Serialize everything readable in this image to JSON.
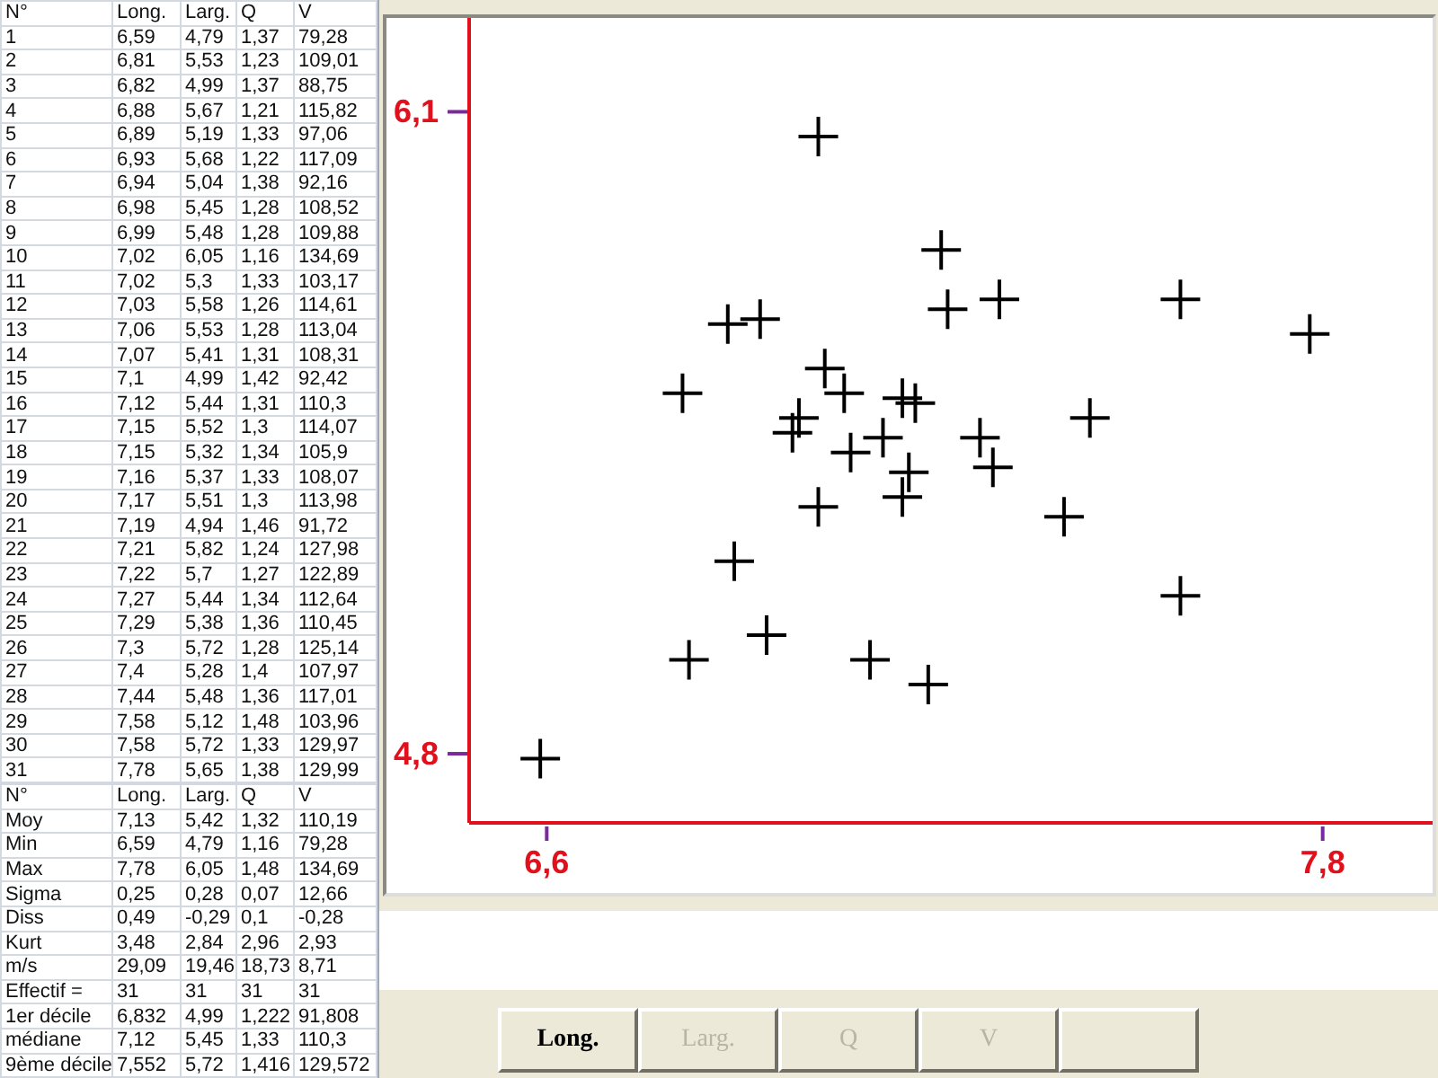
{
  "table": {
    "columns": [
      "N°",
      "Long.",
      "Larg.",
      "Q",
      "V"
    ],
    "rows": [
      [
        "1",
        "6,59",
        "4,79",
        "1,37",
        "79,28"
      ],
      [
        "2",
        "6,81",
        "5,53",
        "1,23",
        "109,01"
      ],
      [
        "3",
        "6,82",
        "4,99",
        "1,37",
        "88,75"
      ],
      [
        "4",
        "6,88",
        "5,67",
        "1,21",
        "115,82"
      ],
      [
        "5",
        "6,89",
        "5,19",
        "1,33",
        "97,06"
      ],
      [
        "6",
        "6,93",
        "5,68",
        "1,22",
        "117,09"
      ],
      [
        "7",
        "6,94",
        "5,04",
        "1,38",
        "92,16"
      ],
      [
        "8",
        "6,98",
        "5,45",
        "1,28",
        "108,52"
      ],
      [
        "9",
        "6,99",
        "5,48",
        "1,28",
        "109,88"
      ],
      [
        "10",
        "7,02",
        "6,05",
        "1,16",
        "134,69"
      ],
      [
        "11",
        "7,02",
        "5,3",
        "1,33",
        "103,17"
      ],
      [
        "12",
        "7,03",
        "5,58",
        "1,26",
        "114,61"
      ],
      [
        "13",
        "7,06",
        "5,53",
        "1,28",
        "113,04"
      ],
      [
        "14",
        "7,07",
        "5,41",
        "1,31",
        "108,31"
      ],
      [
        "15",
        "7,1",
        "4,99",
        "1,42",
        "92,42"
      ],
      [
        "16",
        "7,12",
        "5,44",
        "1,31",
        "110,3"
      ],
      [
        "17",
        "7,15",
        "5,52",
        "1,3",
        "114,07"
      ],
      [
        "18",
        "7,15",
        "5,32",
        "1,34",
        "105,9"
      ],
      [
        "19",
        "7,16",
        "5,37",
        "1,33",
        "108,07"
      ],
      [
        "20",
        "7,17",
        "5,51",
        "1,3",
        "113,98"
      ],
      [
        "21",
        "7,19",
        "4,94",
        "1,46",
        "91,72"
      ],
      [
        "22",
        "7,21",
        "5,82",
        "1,24",
        "127,98"
      ],
      [
        "23",
        "7,22",
        "5,7",
        "1,27",
        "122,89"
      ],
      [
        "24",
        "7,27",
        "5,44",
        "1,34",
        "112,64"
      ],
      [
        "25",
        "7,29",
        "5,38",
        "1,36",
        "110,45"
      ],
      [
        "26",
        "7,3",
        "5,72",
        "1,28",
        "125,14"
      ],
      [
        "27",
        "7,4",
        "5,28",
        "1,4",
        "107,97"
      ],
      [
        "28",
        "7,44",
        "5,48",
        "1,36",
        "117,01"
      ],
      [
        "29",
        "7,58",
        "5,12",
        "1,48",
        "103,96"
      ],
      [
        "30",
        "7,58",
        "5,72",
        "1,33",
        "129,97"
      ],
      [
        "31",
        "7,78",
        "5,65",
        "1,38",
        "129,99"
      ]
    ]
  },
  "stats": {
    "columns": [
      "N°",
      "Long.",
      "Larg.",
      "Q",
      "V"
    ],
    "rows": [
      [
        "Moy",
        "7,13",
        "5,42",
        "1,32",
        "110,19"
      ],
      [
        "Min",
        "6,59",
        "4,79",
        "1,16",
        "79,28"
      ],
      [
        "Max",
        "7,78",
        "6,05",
        "1,48",
        "134,69"
      ],
      [
        "Sigma",
        "0,25",
        "0,28",
        "0,07",
        "12,66"
      ],
      [
        "Diss",
        "0,49",
        "-0,29",
        "0,1",
        "-0,28"
      ],
      [
        "Kurt",
        "3,48",
        "2,84",
        "2,96",
        "2,93"
      ],
      [
        "m/s",
        "29,09",
        "19,46",
        "18,73",
        "8,71"
      ],
      [
        "Effectif =",
        "31",
        "31",
        "31",
        "31"
      ],
      [
        "1er décile",
        "6,832",
        "4,99",
        "1,222",
        "91,808"
      ],
      [
        "médiane",
        "7,12",
        "5,45",
        "1,33",
        "110,3"
      ],
      [
        "9ème décile",
        "7,552",
        "5,72",
        "1,416",
        "129,572"
      ]
    ]
  },
  "chart": {
    "chart_data": {
      "type": "scatter",
      "x": [
        6.59,
        6.81,
        6.82,
        6.88,
        6.89,
        6.93,
        6.94,
        6.98,
        6.99,
        7.02,
        7.02,
        7.03,
        7.06,
        7.07,
        7.1,
        7.12,
        7.15,
        7.15,
        7.16,
        7.17,
        7.19,
        7.21,
        7.22,
        7.27,
        7.29,
        7.3,
        7.4,
        7.44,
        7.58,
        7.58,
        7.78
      ],
      "series": [
        {
          "color": "#000000",
          "values": [
            4.79,
            5.53,
            4.99,
            5.67,
            5.19,
            5.68,
            5.04,
            5.45,
            5.48,
            6.05,
            5.3,
            5.58,
            5.53,
            5.41,
            4.99,
            5.44,
            5.52,
            5.32,
            5.37,
            5.51,
            4.94,
            5.82,
            5.7,
            5.44,
            5.38,
            5.72,
            5.28,
            5.48,
            5.12,
            5.72,
            5.65
          ]
        }
      ],
      "xlim": [
        6.48,
        7.97
      ],
      "ylim": [
        4.66,
        6.29
      ],
      "xticks": [
        {
          "value": 6.6,
          "label": "6,6"
        },
        {
          "value": 7.8,
          "label": "7,8"
        }
      ],
      "yticks": [
        {
          "value": 4.8,
          "label": "4,8"
        },
        {
          "value": 6.1,
          "label": "6,1"
        }
      ]
    }
  },
  "buttons": [
    {
      "kind": "text",
      "label": "Long.",
      "disabled": false
    },
    {
      "kind": "text",
      "label": "Larg.",
      "disabled": true
    },
    {
      "kind": "text",
      "label": "Q",
      "disabled": true
    },
    {
      "kind": "text",
      "label": "V",
      "disabled": true
    },
    {
      "kind": "blank"
    }
  ]
}
